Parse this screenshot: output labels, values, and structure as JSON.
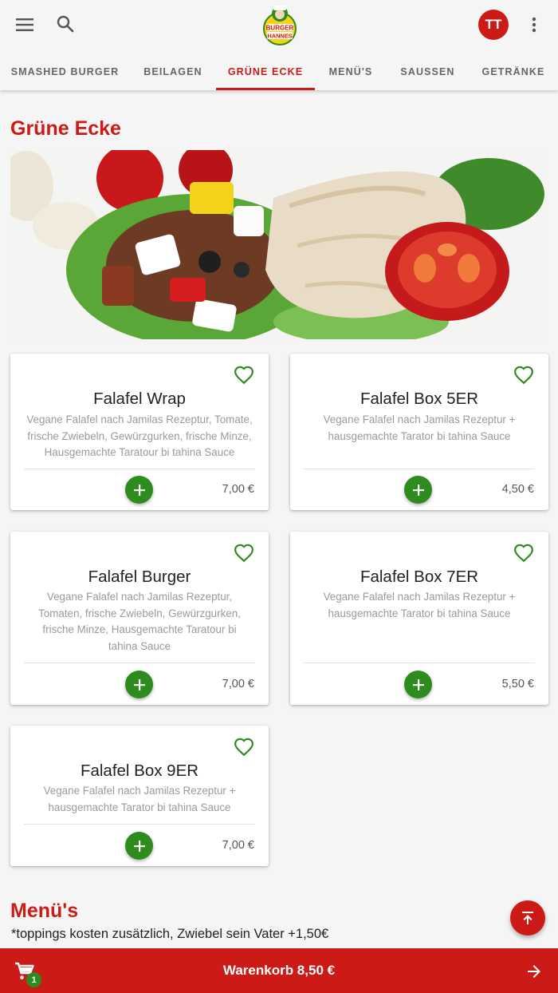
{
  "header": {
    "menu_icon": "hamburger-menu-icon",
    "search_icon": "search-icon",
    "logo_text_1": "BURGER",
    "logo_text_2": "HANNES",
    "avatar_initials": "TT",
    "more_icon": "more-vert-icon"
  },
  "tabs": [
    {
      "label": "Smashed Burger",
      "active": false
    },
    {
      "label": "Beilagen",
      "active": false
    },
    {
      "label": "Grüne Ecke",
      "active": true
    },
    {
      "label": "Menü's",
      "active": false
    },
    {
      "label": "Saussen",
      "active": false
    },
    {
      "label": "Getränke",
      "active": false
    }
  ],
  "section": {
    "title": "Grüne Ecke"
  },
  "products": [
    {
      "name": "Falafel Wrap",
      "description": "Vegane Falafel nach Jamilas Rezeptur, Tomate, frische Zwiebeln, Gewürzgurken, frische Minze, Hausgemachte Taratour bi tahina Sauce",
      "price": "7,00 €"
    },
    {
      "name": "Falafel Box 5ER",
      "description": "Vegane Falafel nach Jamilas Rezeptur + hausgemachte Tarator bi tahina Sauce",
      "price": "4,50 €"
    },
    {
      "name": "Falafel Burger",
      "description": "Vegane Falafel nach Jamilas Rezeptur, Tomaten, frische Zwiebeln, Gewürzgurken, frische Minze, Hausgemachte Taratour bi tahina Sauce",
      "price": "7,00 €"
    },
    {
      "name": "Falafel Box 7ER",
      "description": "Vegane Falafel nach Jamilas Rezeptur + hausgemachte Tarator bi tahina Sauce",
      "price": "5,50 €"
    },
    {
      "name": "Falafel Box 9ER",
      "description": "Vegane Falafel nach Jamilas Rezeptur + hausgemachte Tarator bi tahina Sauce",
      "price": "7,00 €"
    }
  ],
  "next_section": {
    "title": "Menü's",
    "note": "*toppings kosten zusätzlich, Zwiebel sein Vater +1,50€"
  },
  "cart": {
    "label": "Warenkorb 8,50 €",
    "count": "1",
    "cart_icon": "cart-icon",
    "arrow_icon": "arrow-right-icon"
  },
  "colors": {
    "brand_red": "#cc1a16",
    "add_green": "#2e8b1e",
    "heart_green": "#2e8b1e"
  }
}
